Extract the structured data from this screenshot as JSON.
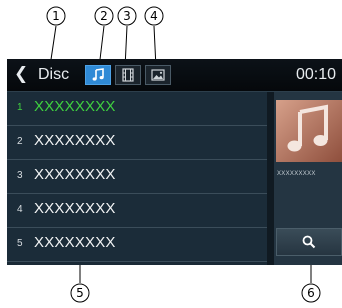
{
  "callouts": [
    "1",
    "2",
    "3",
    "4",
    "5",
    "6"
  ],
  "header": {
    "back_glyph": "❮",
    "source_label": "Disc",
    "mode_buttons": [
      {
        "icon": "music-note-icon",
        "active": true
      },
      {
        "icon": "film-strip-icon",
        "active": false
      },
      {
        "icon": "picture-icon",
        "active": false
      }
    ],
    "clock": "00:10"
  },
  "tracks": [
    {
      "number": "1",
      "title": "XXXXXXXX",
      "active": true
    },
    {
      "number": "2",
      "title": "XXXXXXXX",
      "active": false
    },
    {
      "number": "3",
      "title": "XXXXXXXX",
      "active": false
    },
    {
      "number": "4",
      "title": "XXXXXXXX",
      "active": false
    },
    {
      "number": "5",
      "title": "XXXXXXXX",
      "active": false
    }
  ],
  "now_playing": {
    "art_icon": "music-note-icon",
    "art_label": "XXXXXXXXX"
  },
  "search": {
    "icon": "search-icon"
  },
  "colors": {
    "active_track": "#3fd13f",
    "active_mode": "#2f8ad6",
    "screen_bg": "#1a2a36"
  }
}
